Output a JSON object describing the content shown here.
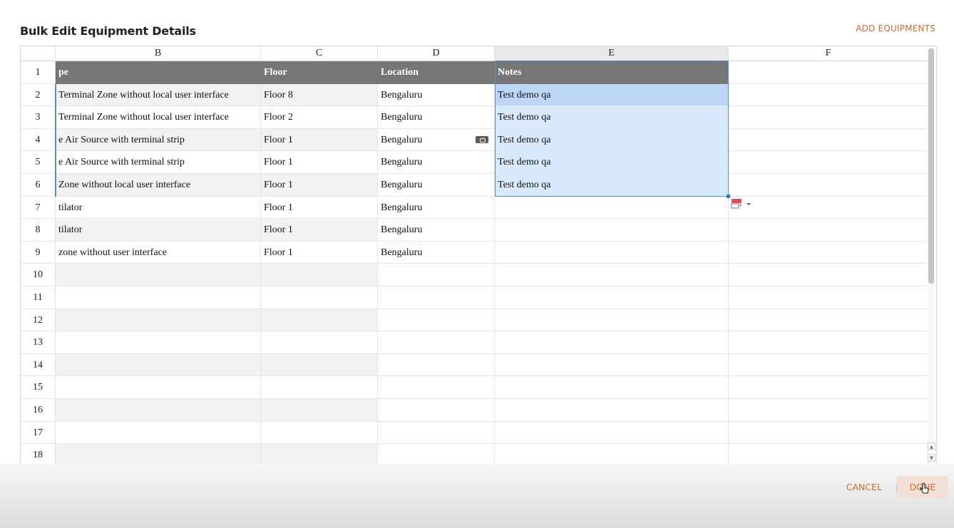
{
  "dialog": {
    "title": "Bulk Edit Equipment Details",
    "add_label": "ADD EQUIPMENTS",
    "cancel_label": "CANCEL",
    "done_label": "DONE"
  },
  "sheet": {
    "column_letters": [
      "B",
      "C",
      "D",
      "E",
      "F"
    ],
    "row_numbers": [
      "1",
      "2",
      "3",
      "4",
      "5",
      "6",
      "7",
      "8",
      "9",
      "10",
      "11",
      "12",
      "13",
      "14",
      "15",
      "16",
      "17",
      "18"
    ],
    "headers": [
      "pe",
      "Floor",
      "Location",
      "Notes",
      ""
    ],
    "rows": [
      [
        "Terminal Zone without local user interface",
        "Floor 8",
        "Bengaluru",
        "Test demo qa",
        ""
      ],
      [
        "Terminal Zone without local user interface",
        "Floor 2",
        "Bengaluru",
        "Test demo qa",
        ""
      ],
      [
        "e Air Source with terminal strip",
        "Floor 1",
        "Bengaluru",
        "Test demo qa",
        ""
      ],
      [
        "e Air Source with terminal strip",
        "Floor 1",
        "Bengaluru",
        "Test demo qa",
        ""
      ],
      [
        "Zone without local user interface",
        "Floor 1",
        "Bengaluru",
        "Test demo qa",
        ""
      ],
      [
        "tilator",
        "Floor 1",
        "Bengaluru",
        "",
        ""
      ],
      [
        "tilator",
        "Floor 1",
        "Bengaluru",
        "",
        ""
      ],
      [
        "zone without user interface",
        "Floor 1",
        "Bengaluru",
        "",
        ""
      ]
    ],
    "selected_column": "E",
    "selection": {
      "first_row": 2,
      "last_row": 6,
      "column": "E"
    }
  },
  "icons": {
    "paste": "paste-options-icon",
    "autofill": "autofill-options-icon",
    "cursor": "hand-pointer-icon"
  },
  "colors": {
    "accent": "#d9692a",
    "header_bg": "#767676",
    "selection_bg": "#d8e9fb",
    "selection_border": "#4f8fe0"
  }
}
